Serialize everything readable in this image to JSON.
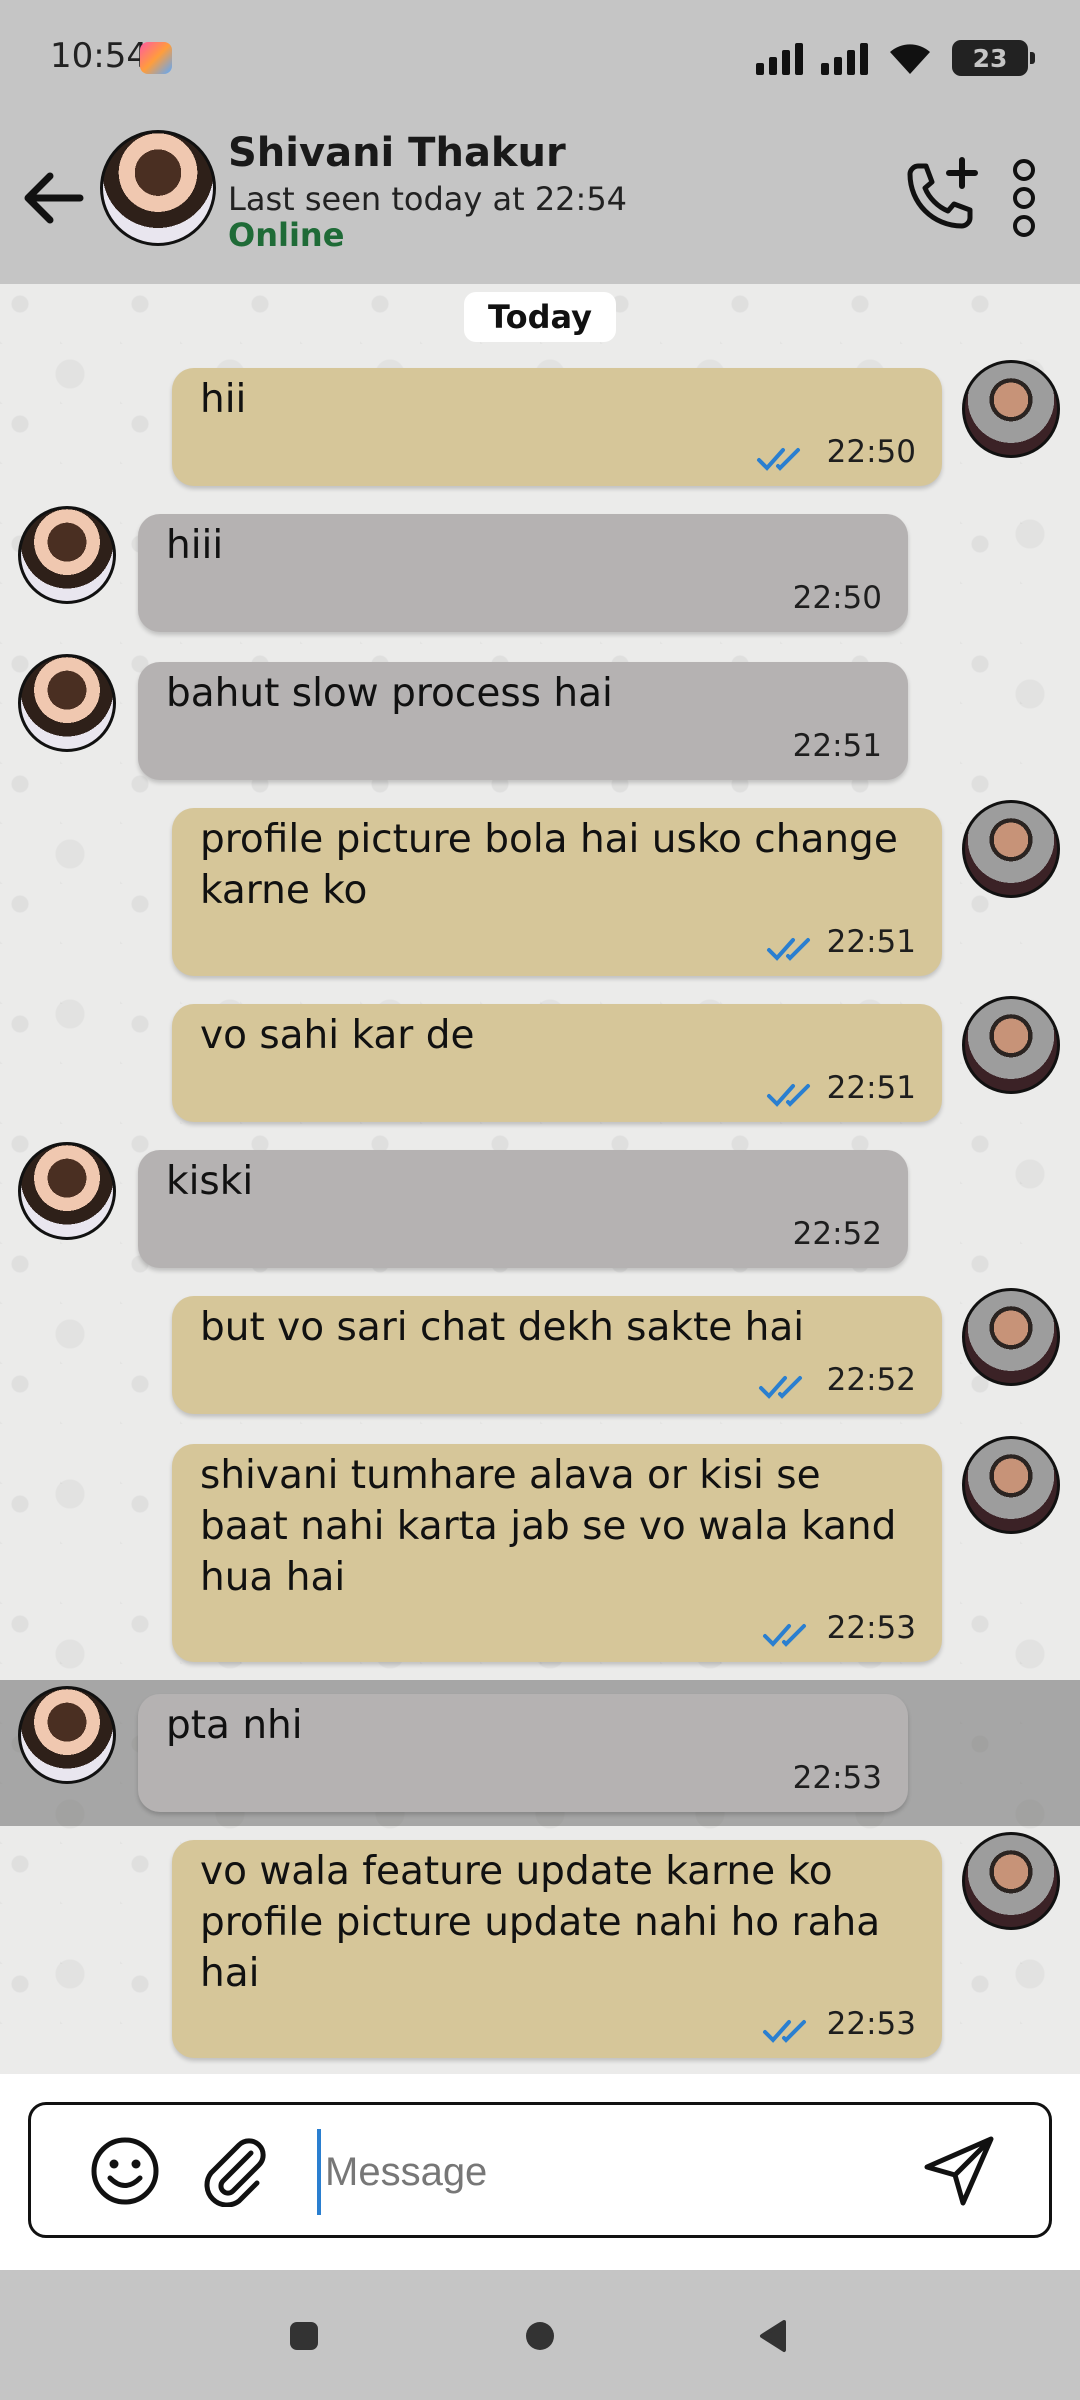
{
  "status_bar": {
    "time": "10:54",
    "battery": "23"
  },
  "header": {
    "contact_name": "Shivani Thakur",
    "last_seen": "Last seen today at 22:54",
    "presence": "Online"
  },
  "chat": {
    "date_label": "Today",
    "messages": [
      {
        "direction": "out",
        "text": "hii",
        "time": "22:50",
        "read": true
      },
      {
        "direction": "in",
        "text": "hiii",
        "time": "22:50"
      },
      {
        "direction": "in",
        "text": "bahut slow process hai",
        "time": "22:51"
      },
      {
        "direction": "out",
        "text": "profile picture bola hai usko change karne ko",
        "time": "22:51",
        "read": true
      },
      {
        "direction": "out",
        "text": "vo sahi kar de",
        "time": "22:51",
        "read": true
      },
      {
        "direction": "in",
        "text": "kiski",
        "time": "22:52"
      },
      {
        "direction": "out",
        "text": "but vo sari chat dekh sakte hai",
        "time": "22:52",
        "read": true
      },
      {
        "direction": "out",
        "text": "shivani tumhare alava or kisi se baat nahi karta jab se vo wala kand hua hai",
        "time": "22:53",
        "read": true
      },
      {
        "direction": "in",
        "text": "pta nhi",
        "time": "22:53",
        "highlighted": true
      },
      {
        "direction": "out",
        "text": "vo wala feature update karne ko profile picture update nahi ho raha hai",
        "time": "22:53",
        "read": true
      }
    ]
  },
  "composer": {
    "placeholder": "Message"
  },
  "icons": {
    "back": "arrow-left-icon",
    "call": "phone-plus-icon",
    "more": "more-vertical-icon",
    "emoji": "smiley-icon",
    "attach": "paperclip-icon",
    "send": "send-icon",
    "read_receipt": "double-check-icon"
  },
  "colors": {
    "outgoing_bubble": "#d6c699",
    "incoming_bubble": "#b5b2b2",
    "online": "#1f6b37",
    "read_ticks": "#2a7fd0"
  }
}
